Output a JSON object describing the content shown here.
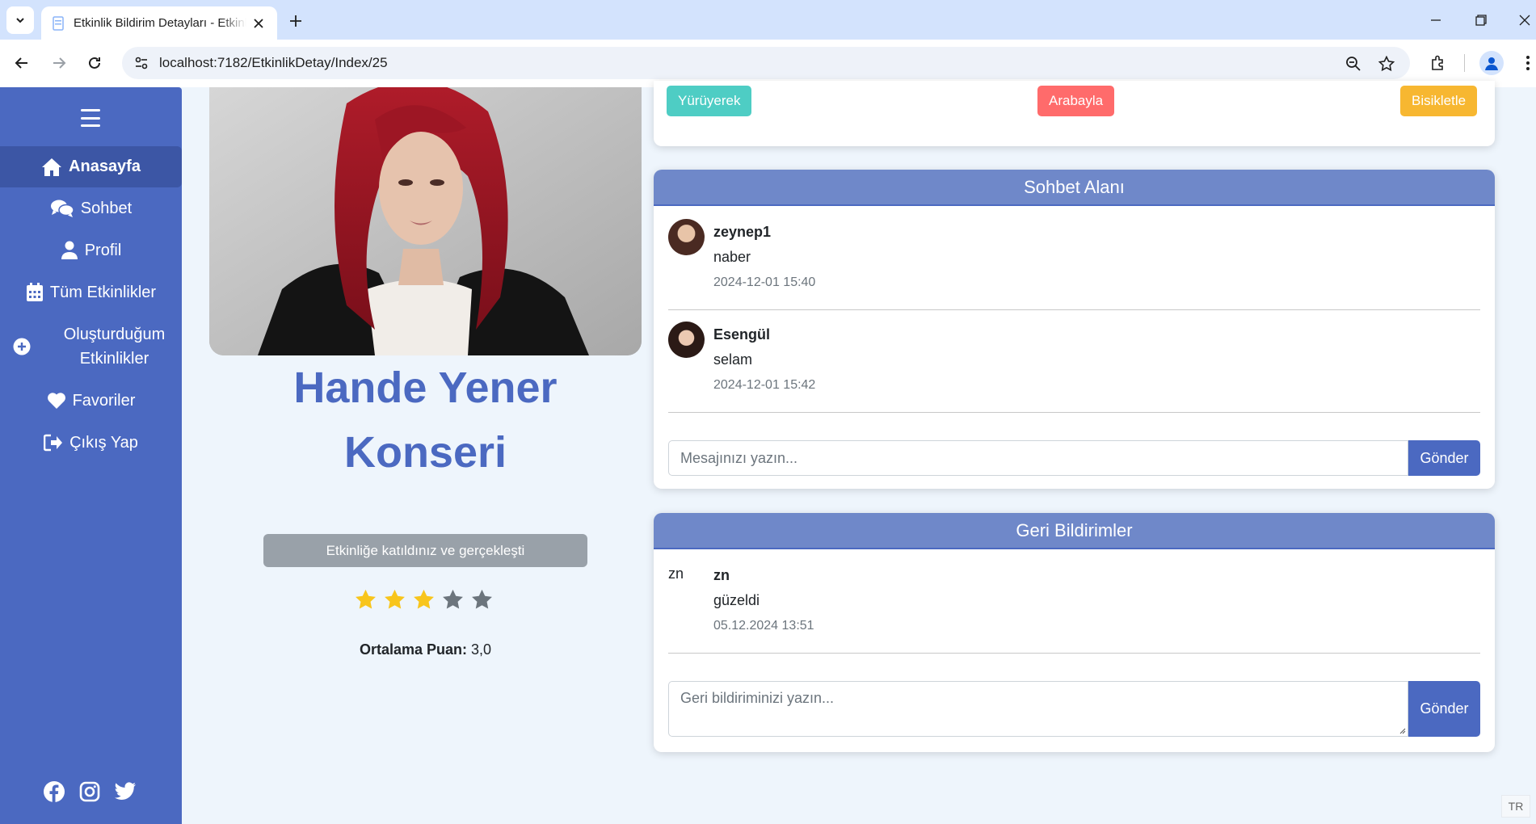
{
  "browser": {
    "tab_title": "Etkinlik Bildirim Detayları - Etkinlik",
    "url": "localhost:7182/EtkinlikDetay/Index/25"
  },
  "sidebar": {
    "items": [
      {
        "label": "Anasayfa",
        "icon": "home-icon",
        "active": true
      },
      {
        "label": "Sohbet",
        "icon": "comments-icon"
      },
      {
        "label": "Profil",
        "icon": "user-icon"
      },
      {
        "label": "Tüm Etkinlikler",
        "icon": "calendar-icon"
      },
      {
        "label": "Oluşturduğum Etkinlikler",
        "icon": "plus-circle-icon"
      },
      {
        "label": "Favoriler",
        "icon": "heart-icon"
      },
      {
        "label": "Çıkış Yap",
        "icon": "logout-icon"
      }
    ],
    "social": [
      "facebook-icon",
      "instagram-icon",
      "twitter-icon"
    ]
  },
  "event": {
    "title_line1": "Hande Yener",
    "title_line2": "Konseri",
    "status": "Etkinliğe katıldınız ve gerçekleşti",
    "rating": 3,
    "rating_max": 5,
    "avg_label": "Ortalama Puan:",
    "avg_value": "3,0"
  },
  "transport": {
    "walk": "Yürüyerek",
    "car": "Arabayla",
    "bike": "Bisikletle"
  },
  "chat": {
    "title": "Sohbet Alanı",
    "messages": [
      {
        "user": "zeynep1",
        "text": "naber",
        "time": "2024-12-01 15:40"
      },
      {
        "user": "Esengül",
        "text": "selam",
        "time": "2024-12-01 15:42"
      }
    ],
    "placeholder": "Mesajınızı yazın...",
    "send": "Gönder"
  },
  "feedback": {
    "title": "Geri Bildirimler",
    "items": [
      {
        "avatar_alt": "zn",
        "user": "zn",
        "text": "güzeldi",
        "time": "05.12.2024 13:51"
      }
    ],
    "placeholder": "Geri bildiriminizi yazın...",
    "send": "Gönder"
  },
  "colors": {
    "sidebar": "#4b69c1",
    "card_header": "#6f88c9",
    "walk": "#4ecdc4",
    "car": "#ff6b6b",
    "bike": "#f7b731",
    "star_on": "#f8c51c",
    "star_off": "#6c757d"
  },
  "lang_indicator": "TR"
}
